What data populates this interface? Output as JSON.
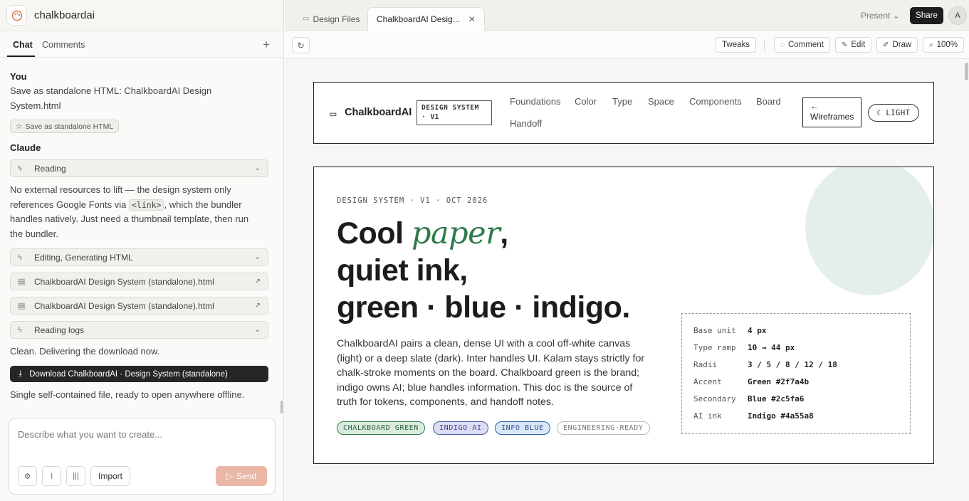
{
  "app": {
    "name": "chalkboardai"
  },
  "chat_tabs": {
    "chat": "Chat",
    "comments": "Comments",
    "add": "+"
  },
  "messages": {
    "user_author": "You",
    "user_line1": "Save as standalone HTML: ChalkboardAI Design",
    "user_line2": "System.html",
    "user_chip": "Save as standalone HTML",
    "assistant_author": "Claude",
    "tool_reading": "Reading",
    "para1_a": "No external resources to lift — the design system only",
    "para1_b_pre": "references Google Fonts via",
    "para1_code": "<link>",
    "para1_b_post": ", which the bundler",
    "para1_c": "handles natively. Just need a thumbnail template, then run",
    "para1_d": "the bundler.",
    "tool_editing": "Editing, Generating HTML",
    "file1": "ChalkboardAI Design System (standalone).html",
    "file2": "ChalkboardAI Design System (standalone).html",
    "tool_logs": "Reading logs",
    "clean": "Clean. Delivering the download now.",
    "download": "Download ChalkboardAI · Design System (standalone)",
    "final": "Single self-contained file, ready to open anywhere offline."
  },
  "composer": {
    "placeholder": "Describe what you want to create...",
    "import": "Import",
    "send": "Send"
  },
  "tabs": {
    "design_files": "Design Files",
    "active": "ChalkboardAI Desig...",
    "close": "✕"
  },
  "topbar": {
    "present": "Present",
    "share": "Share",
    "avatar": "A"
  },
  "toolbar": {
    "tweaks": "Tweaks",
    "comment": "Comment",
    "edit": "Edit",
    "draw": "Draw",
    "zoom": "100%"
  },
  "doc": {
    "brand": "ChalkboardAI",
    "badge_line1": "DESIGN SYSTEM",
    "badge_line2": "· V1",
    "nav": [
      "Foundations",
      "Color",
      "Type",
      "Space",
      "Components",
      "Board",
      "Handoff"
    ],
    "wire_arrow": "←",
    "wire_label": "Wireframes",
    "light_label": "LIGHT",
    "eyebrow": "DESIGN SYSTEM · V1 · OCT 2026",
    "head_cool": "Cool ",
    "head_paper": "paper",
    "head_comma": ",",
    "head_line2": "quiet ink,",
    "head_line3": "green · blue · indigo.",
    "lede": "ChalkboardAI pairs a clean, dense UI with a cool off-white canvas (light) or a deep slate (dark). Inter handles UI. Kalam stays strictly for chalk-stroke moments on the board. Chalkboard green is the brand; indigo owns AI; blue handles information. This doc is the source of truth for tokens, components, and handoff notes.",
    "pills": [
      "CHALKBOARD GREEN",
      "INDIGO AI",
      "INFO BLUE",
      "ENGINEERING-READY"
    ],
    "specs": [
      {
        "k": "Base unit",
        "v": "4 px"
      },
      {
        "k": "Type ramp",
        "v": "10 → 44 px"
      },
      {
        "k": "Radii",
        "v": "3 / 5 / 8 / 12 / 18"
      },
      {
        "k": "Accent",
        "v": "Green #2f7a4b"
      },
      {
        "k": "Secondary",
        "v": "Blue #2c5fa6"
      },
      {
        "k": "AI ink",
        "v": "Indigo #4a55a8"
      }
    ]
  },
  "colors": {
    "accent_green": "#2f7a4b",
    "secondary_blue": "#2c5fa6",
    "ai_indigo": "#4a55a8",
    "send": "#eab6a6"
  }
}
